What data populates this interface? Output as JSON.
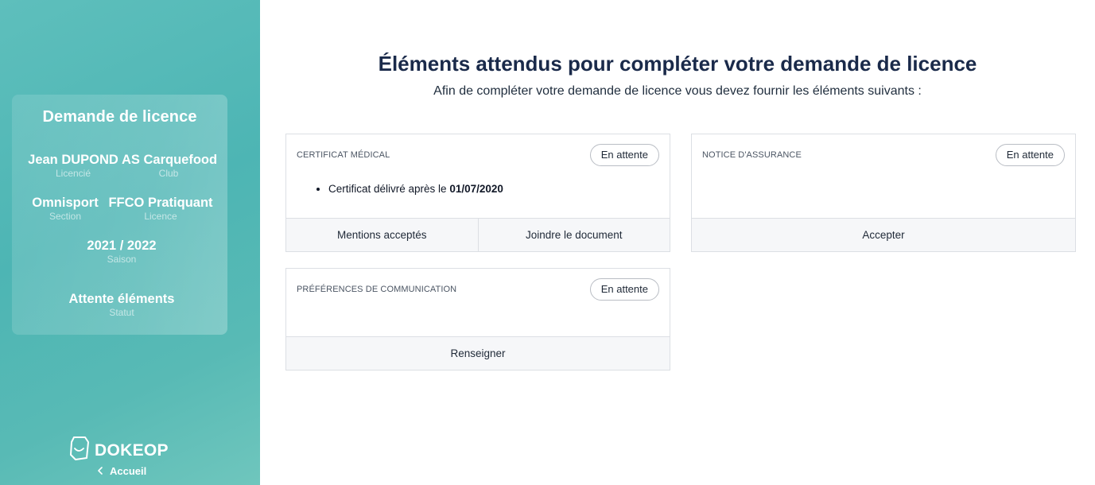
{
  "sidebar": {
    "summary": {
      "title": "Demande de licence",
      "name": {
        "value": "Jean DUPOND",
        "label": "Licencié"
      },
      "club": {
        "value": "AS Carquefood",
        "label": "Club"
      },
      "section": {
        "value": "Omnisport",
        "label": "Section"
      },
      "licence": {
        "value": "FFCO Pratiquant",
        "label": "Licence"
      },
      "season": {
        "value": "2021 / 2022",
        "label": "Saison"
      },
      "status": {
        "value": "Attente éléments",
        "label": "Statut"
      }
    },
    "brand": {
      "name": "DOKEOP",
      "icon": "dokeop-logo-icon"
    },
    "home_link": {
      "label": "Accueil",
      "icon": "chevron-left-icon"
    }
  },
  "main": {
    "title": "Éléments attendus pour compléter votre demande de licence",
    "subtitle": "Afin de compléter votre demande de licence vous devez fournir les éléments suivants :",
    "cards": {
      "medical": {
        "title": "CERTIFICAT MÉDICAL",
        "status": "En attente",
        "bullet_prefix": "Certificat délivré après le ",
        "bullet_date": "01/07/2020",
        "actions": [
          "Mentions acceptés",
          "Joindre le document"
        ]
      },
      "insurance": {
        "title": "NOTICE D'ASSURANCE",
        "status": "En attente",
        "actions": [
          "Accepter"
        ]
      },
      "communication": {
        "title": "PRÉFÉRENCES DE COMMUNICATION",
        "status": "En attente",
        "actions": [
          "Renseigner"
        ]
      }
    }
  },
  "colors": {
    "sidebar_gradient_start": "#5ebfbc",
    "sidebar_gradient_end": "#6fc6bd",
    "title": "#1a2a4a",
    "card_border": "#dcdfe4",
    "action_bg": "#f6f7f9"
  }
}
